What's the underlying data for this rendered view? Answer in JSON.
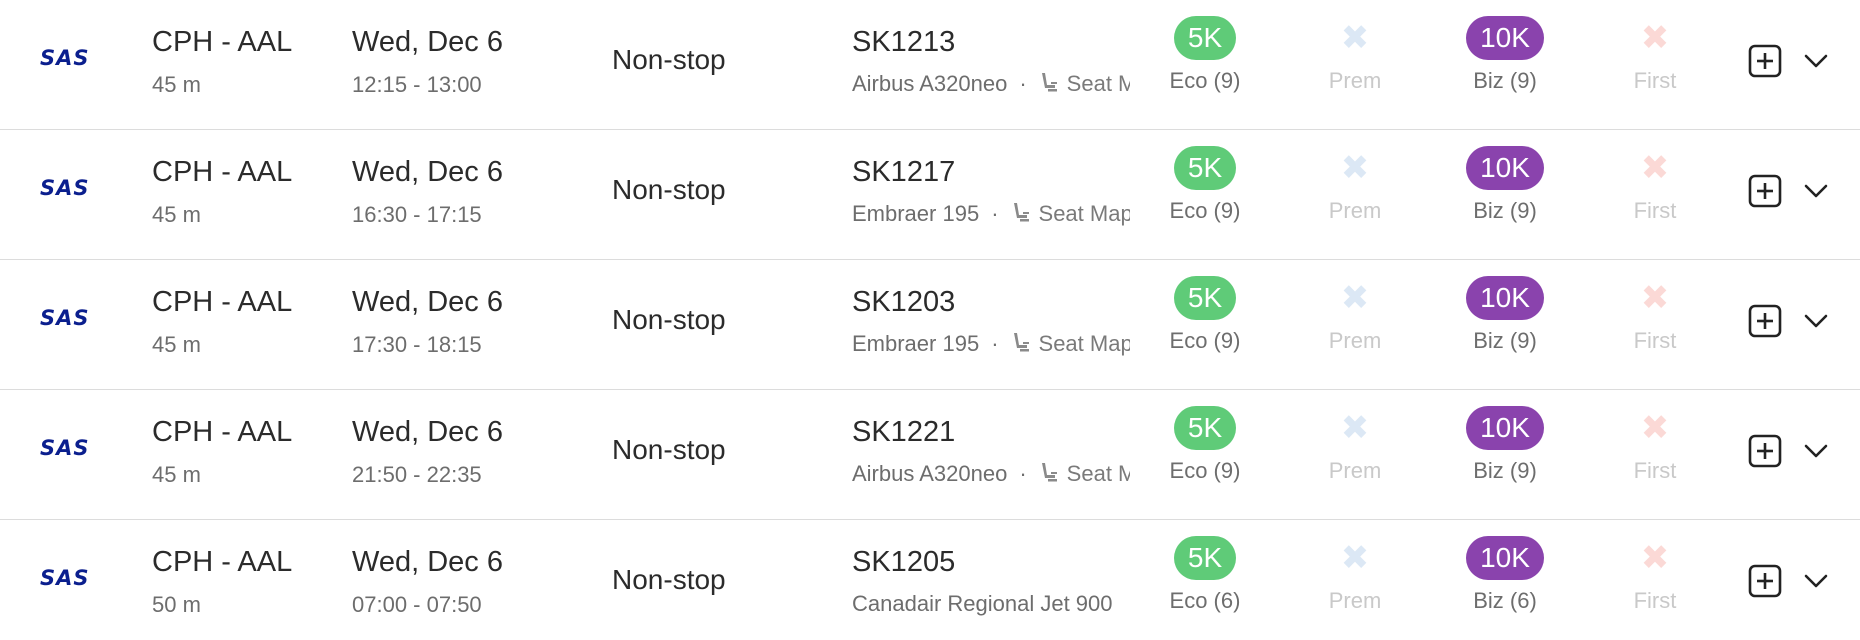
{
  "colors": {
    "economy_badge": "#5fcb78",
    "business_badge": "#8a43ad",
    "premium_unavailable": "#dce8f5",
    "first_unavailable": "#fbd9d6",
    "airline_logo": "#0b1f8e"
  },
  "icons": {
    "seat": "seat-icon",
    "add": "plus-square-icon",
    "expand": "chevron-down-icon",
    "unavailable": "x-icon"
  },
  "flights": [
    {
      "airline": "SAS",
      "route": "CPH - AAL",
      "duration": "45 m",
      "date": "Wed, Dec 6",
      "times": "12:15 - 13:00",
      "stops": "Non-stop",
      "flight_number": "SK1213",
      "aircraft": "Airbus A320neo",
      "seat_map": "Seat Map",
      "show_seat_map": true,
      "eco": {
        "value": "5K",
        "label": "Eco (9)"
      },
      "prem": {
        "label": "Prem"
      },
      "biz": {
        "value": "10K",
        "label": "Biz (9)"
      },
      "first": {
        "label": "First"
      }
    },
    {
      "airline": "SAS",
      "route": "CPH - AAL",
      "duration": "45 m",
      "date": "Wed, Dec 6",
      "times": "16:30 - 17:15",
      "stops": "Non-stop",
      "flight_number": "SK1217",
      "aircraft": "Embraer 195",
      "seat_map": "Seat Map",
      "show_seat_map": true,
      "eco": {
        "value": "5K",
        "label": "Eco (9)"
      },
      "prem": {
        "label": "Prem"
      },
      "biz": {
        "value": "10K",
        "label": "Biz (9)"
      },
      "first": {
        "label": "First"
      }
    },
    {
      "airline": "SAS",
      "route": "CPH - AAL",
      "duration": "45 m",
      "date": "Wed, Dec 6",
      "times": "17:30 - 18:15",
      "stops": "Non-stop",
      "flight_number": "SK1203",
      "aircraft": "Embraer 195",
      "seat_map": "Seat Map",
      "show_seat_map": true,
      "eco": {
        "value": "5K",
        "label": "Eco (9)"
      },
      "prem": {
        "label": "Prem"
      },
      "biz": {
        "value": "10K",
        "label": "Biz (9)"
      },
      "first": {
        "label": "First"
      }
    },
    {
      "airline": "SAS",
      "route": "CPH - AAL",
      "duration": "45 m",
      "date": "Wed, Dec 6",
      "times": "21:50 - 22:35",
      "stops": "Non-stop",
      "flight_number": "SK1221",
      "aircraft": "Airbus A320neo",
      "seat_map": "Seat Map",
      "show_seat_map": true,
      "eco": {
        "value": "5K",
        "label": "Eco (9)"
      },
      "prem": {
        "label": "Prem"
      },
      "biz": {
        "value": "10K",
        "label": "Biz (9)"
      },
      "first": {
        "label": "First"
      }
    },
    {
      "airline": "SAS",
      "route": "CPH - AAL",
      "duration": "50 m",
      "date": "Wed, Dec 6",
      "times": "07:00 - 07:50",
      "stops": "Non-stop",
      "flight_number": "SK1205",
      "aircraft": "Canadair Regional Jet 900",
      "seat_map": "",
      "show_seat_map": false,
      "eco": {
        "value": "5K",
        "label": "Eco (6)"
      },
      "prem": {
        "label": "Prem"
      },
      "biz": {
        "value": "10K",
        "label": "Biz (6)"
      },
      "first": {
        "label": "First"
      }
    }
  ]
}
